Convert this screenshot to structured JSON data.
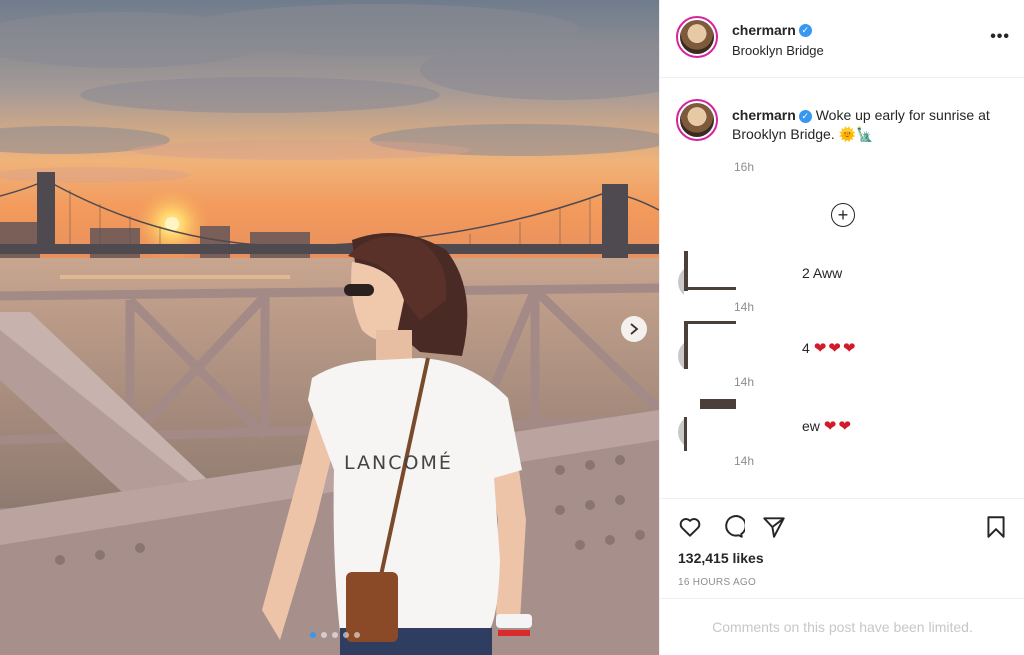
{
  "post": {
    "username": "chermarn",
    "location": "Brooklyn Bridge",
    "caption_text": "Woke up early for sunrise at Brooklyn Bridge.",
    "caption_emoji": "🌞🗽",
    "caption_time": "16h",
    "shirt_print": "LANCOMÉ",
    "likes": "132,415 likes",
    "posted_ago": "16 HOURS AGO",
    "comments_limited": "Comments on this post have been limited.",
    "carousel": {
      "slide_count": 5,
      "active_index": 0
    }
  },
  "comments": [
    {
      "text": "2 Aww",
      "hearts": "",
      "time": "14h"
    },
    {
      "text": "4",
      "hearts": "❤❤❤",
      "time": "14h"
    },
    {
      "text": "ew",
      "hearts": "❤❤",
      "time": "14h"
    }
  ],
  "icons": {
    "more": "more-options-icon",
    "verified": "verified-badge-icon",
    "load_more": "add-circle-icon",
    "like": "heart-icon",
    "comment": "comment-bubble-icon",
    "share": "paper-plane-icon",
    "save": "bookmark-icon",
    "carousel_next": "chevron-right-icon"
  },
  "colors": {
    "verified_blue": "#3897f0",
    "heart_red": "#d21a2b",
    "muted_text": "#8e8e8e"
  }
}
